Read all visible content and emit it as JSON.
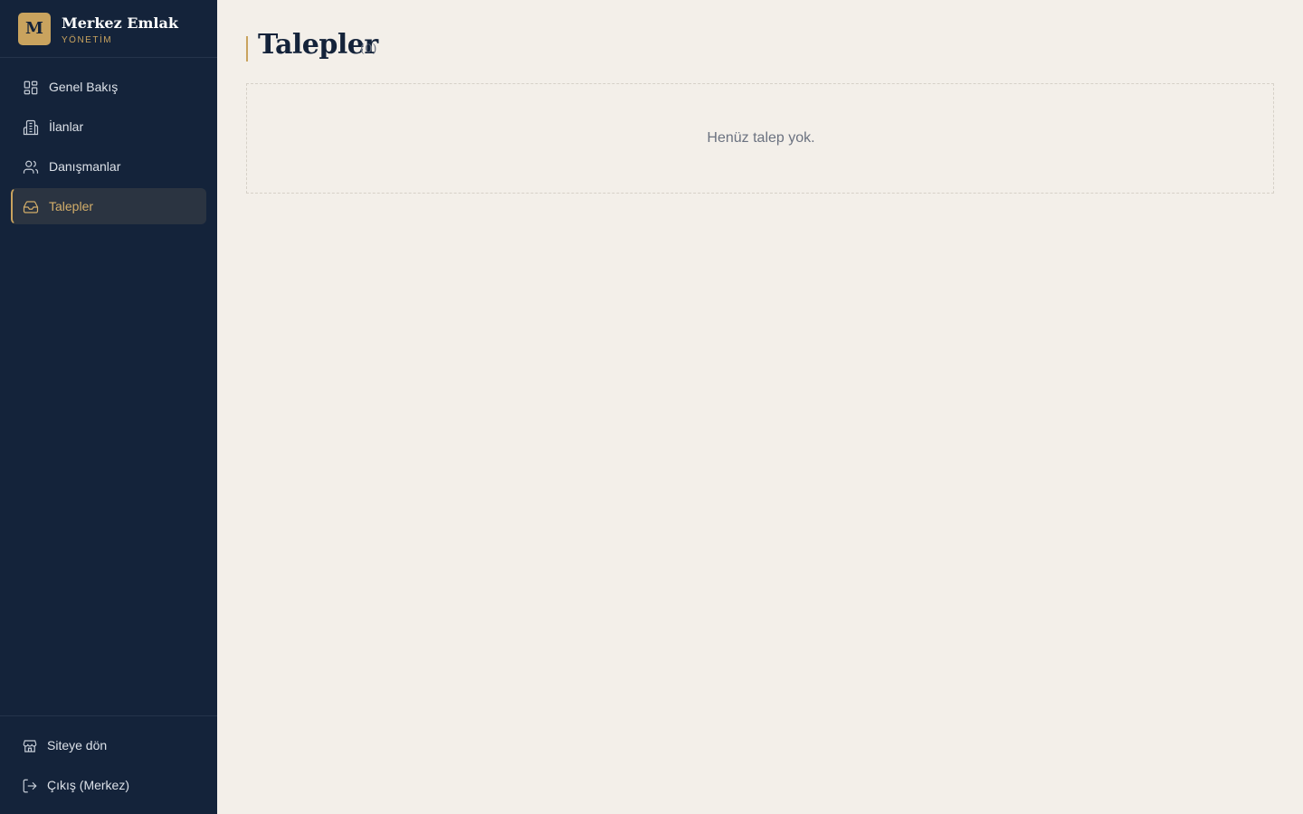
{
  "brand": {
    "logo_letter": "M",
    "name": "Merkez Emlak",
    "subtitle": "YÖNETİM"
  },
  "colors": {
    "sidebar_bg": "#14233a",
    "accent_gold": "#c9a35e",
    "page_bg": "#f3efe9",
    "title_text": "#14233a"
  },
  "sidebar": {
    "items": [
      {
        "label": "Genel Bakış",
        "icon": "dashboard-grid-icon",
        "active": false
      },
      {
        "label": "İlanlar",
        "icon": "building-icon",
        "active": false
      },
      {
        "label": "Danışmanlar",
        "icon": "users-icon",
        "active": false
      },
      {
        "label": "Talepler",
        "icon": "inbox-icon",
        "active": true
      }
    ],
    "bottom": [
      {
        "label": "Siteye dön",
        "icon": "store-icon"
      },
      {
        "label": "Çıkış (Merkez)",
        "icon": "logout-icon"
      }
    ]
  },
  "main": {
    "title": "Talepler",
    "count": "(0)",
    "empty_message": "Henüz talep yok."
  }
}
